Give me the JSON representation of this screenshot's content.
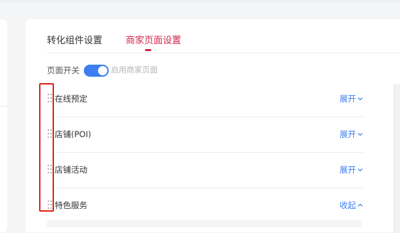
{
  "tabs": [
    {
      "label": "转化组件设置",
      "active": false
    },
    {
      "label": "商家页面设置",
      "active": true
    }
  ],
  "page_switch": {
    "label": "页面开关",
    "state": "on",
    "text": "启用商家页面"
  },
  "sections": [
    {
      "title": "在线预定",
      "action": "展开",
      "expanded": false
    },
    {
      "title": "店铺(POI)",
      "action": "展开",
      "expanded": false
    },
    {
      "title": "店铺活动",
      "action": "展开",
      "expanded": false
    },
    {
      "title": "特色服务",
      "action": "收起",
      "expanded": true
    }
  ],
  "colors": {
    "accent_tab": "#d1264c",
    "link_blue": "#3d7ff0",
    "annotation_red": "#e0251b"
  },
  "icons": {
    "drag_handle": "drag-handle-icon",
    "expand": "chevron-down-icon",
    "collapse": "chevron-up-icon"
  }
}
